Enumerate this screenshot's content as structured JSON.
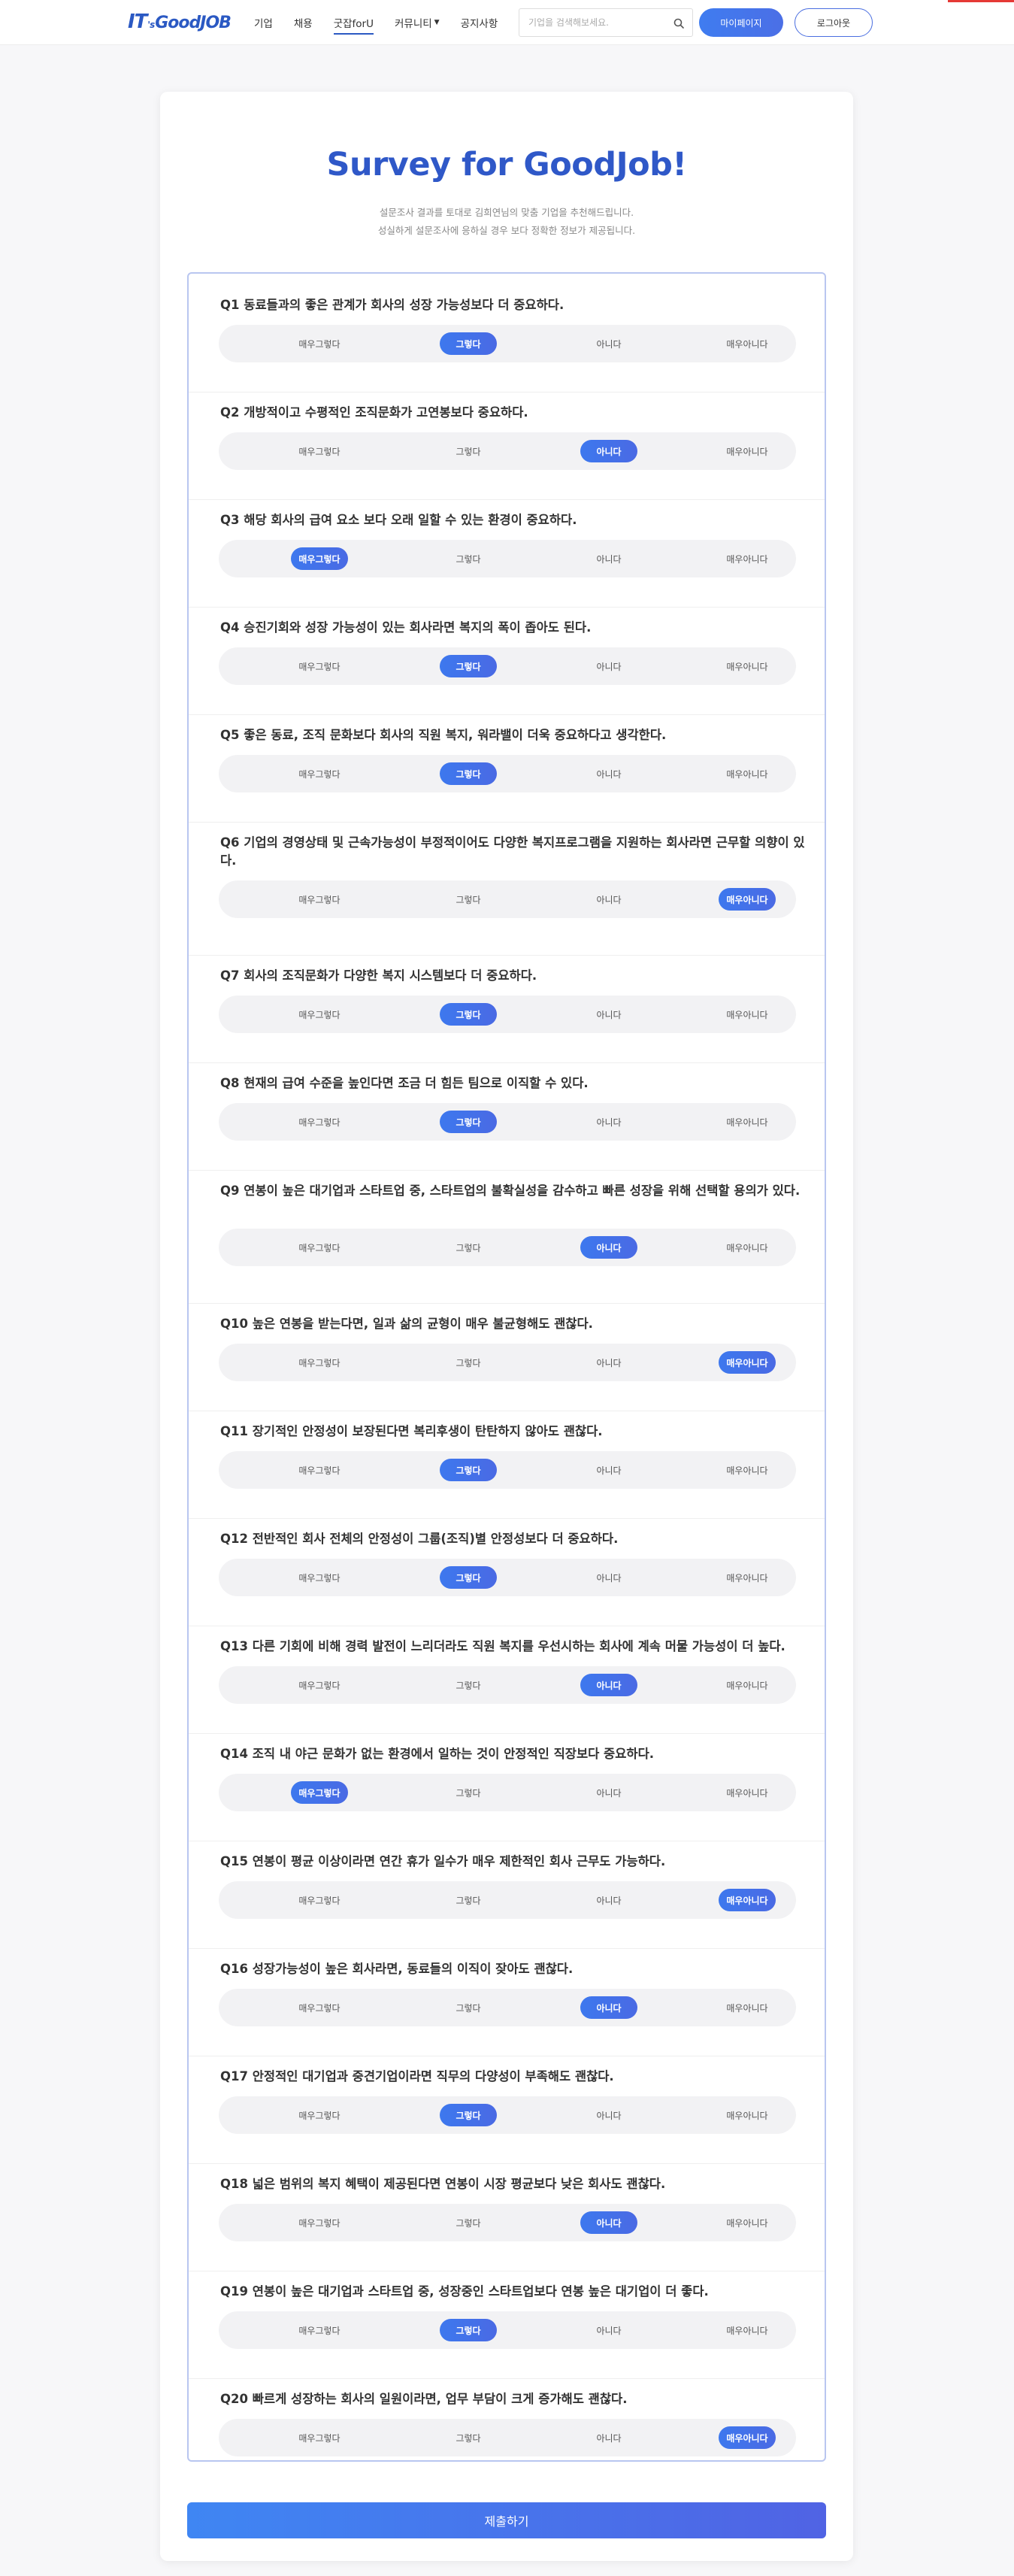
{
  "header": {
    "logo": {
      "big": "IT",
      "small": "'s",
      "rest": "GoodJOB"
    },
    "nav": [
      {
        "label": "기업"
      },
      {
        "label": "채용"
      },
      {
        "label": "굿잡forU"
      },
      {
        "label": "커뮤니티"
      },
      {
        "label": "공지사항"
      }
    ],
    "search_placeholder": "기업을 검색해보세요.",
    "mypage_label": "마이페이지",
    "logout_label": "로그아웃",
    "accent_color": "#2b59c3"
  },
  "survey": {
    "title": "Survey for GoodJob!",
    "subtitle1": "설문조사 결과를 토대로 김희연님의 맞춤 기업을 추천해드립니다.",
    "subtitle2": "성실하게 설문조사에 응하실 경우 보다 정확한 정보가 제공됩니다.",
    "options": [
      "매우그렇다",
      "그렇다",
      "아니다",
      "매우아니다"
    ],
    "questions": [
      {
        "num": "Q1",
        "text": "동료들과의 좋은 관계가 회사의 성장 가능성보다 더 중요하다.",
        "selected": 1
      },
      {
        "num": "Q2",
        "text": "개방적이고 수평적인 조직문화가 고연봉보다 중요하다.",
        "selected": 2
      },
      {
        "num": "Q3",
        "text": "해당 회사의 급여 요소 보다 오래 일할 수 있는 환경이 중요하다.",
        "selected": 0
      },
      {
        "num": "Q4",
        "text": "승진기회와 성장 가능성이 있는 회사라면 복지의 폭이 좁아도 된다.",
        "selected": 1
      },
      {
        "num": "Q5",
        "text": "좋은 동료, 조직 문화보다 회사의 직원 복지, 워라밸이 더욱 중요하다고 생각한다.",
        "selected": 1
      },
      {
        "num": "Q6",
        "text": "기업의 경영상태 및 근속가능성이 부정적이어도 다양한 복지프로그램을 지원하는 회사라면 근무할 의향이 있다.",
        "selected": 3
      },
      {
        "num": "Q7",
        "text": "회사의 조직문화가 다양한 복지 시스템보다 더 중요하다.",
        "selected": 1
      },
      {
        "num": "Q8",
        "text": "현재의 급여 수준을 높인다면 조금 더 힘든 팀으로 이직할 수 있다.",
        "selected": 1
      },
      {
        "num": "Q9",
        "text": "연봉이 높은 대기업과 스타트업 중, 스타트업의 불확실성을 감수하고 빠른 성장을 위해 선택할 용의가 있다.",
        "selected": 2
      },
      {
        "num": "Q10",
        "text": "높은 연봉을 받는다면, 일과 삶의 균형이 매우 불균형해도 괜찮다.",
        "selected": 3
      },
      {
        "num": "Q11",
        "text": "장기적인 안정성이 보장된다면 복리후생이 탄탄하지 않아도 괜찮다.",
        "selected": 1
      },
      {
        "num": "Q12",
        "text": "전반적인 회사 전체의 안정성이 그룹(조직)별 안정성보다 더 중요하다.",
        "selected": 1
      },
      {
        "num": "Q13",
        "text": "다른 기회에 비해 경력 발전이 느리더라도 직원 복지를 우선시하는 회사에 계속 머물 가능성이 더 높다.",
        "selected": 2
      },
      {
        "num": "Q14",
        "text": "조직 내 야근 문화가 없는 환경에서 일하는 것이 안정적인 직장보다 중요하다.",
        "selected": 0
      },
      {
        "num": "Q15",
        "text": "연봉이 평균 이상이라면 연간 휴가 일수가 매우 제한적인 회사 근무도 가능하다.",
        "selected": 3
      },
      {
        "num": "Q16",
        "text": "성장가능성이 높은 회사라면, 동료들의 이직이 잦아도 괜찮다.",
        "selected": 2
      },
      {
        "num": "Q17",
        "text": "안정적인 대기업과 중견기업이라면 직무의 다양성이 부족해도 괜찮다.",
        "selected": 1
      },
      {
        "num": "Q18",
        "text": "넓은 범위의 복지 혜택이 제공된다면 연봉이 시장 평균보다 낮은 회사도 괜찮다.",
        "selected": 2
      },
      {
        "num": "Q19",
        "text": "연봉이 높은 대기업과 스타트업 중, 성장중인 스타트업보다 연봉 높은 대기업이 더 좋다.",
        "selected": 1
      },
      {
        "num": "Q20",
        "text": "빠르게 성장하는 회사의 일원이라면, 업무 부담이 크게 증가해도 괜찮다.",
        "selected": 3
      }
    ],
    "submit_label": "제출하기"
  }
}
